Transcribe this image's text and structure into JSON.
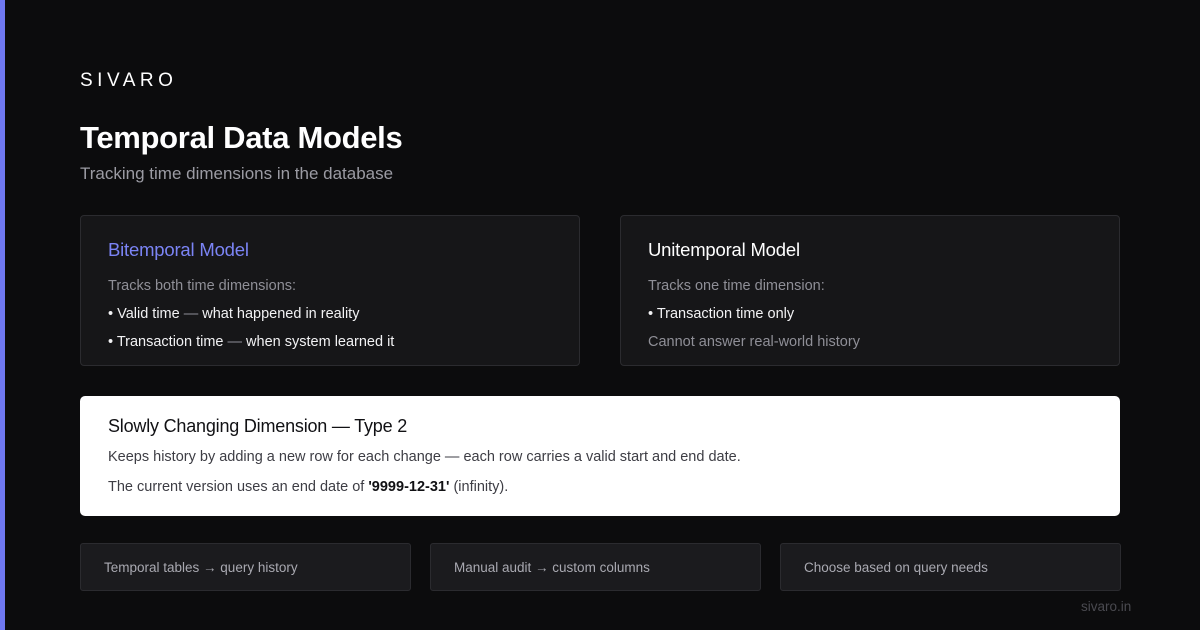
{
  "brand": "SIVARO",
  "title": "Temporal Data Models",
  "subtitle": "Tracking time dimensions in the database",
  "cards": [
    {
      "title": "Bitemporal Model",
      "intro": "Tracks both time dimensions:",
      "line2_a": "• Valid time",
      "line2_sep": "—",
      "line2_b": "what happened in reality",
      "line3_a": "• Transaction time",
      "line3_sep": "—",
      "line3_b": "when system learned it"
    },
    {
      "title": "Unitemporal Model",
      "intro": "Tracks one time dimension:",
      "line2": "• Transaction time only",
      "line3": "Cannot answer real-world history"
    }
  ],
  "scd": {
    "title": "Slowly Changing Dimension — Type 2",
    "line1": "Keeps history by adding a new row for each change — each row carries a valid start and end date.",
    "line2_prefix": "The current version uses an end date of",
    "line2_value": "'9999-12-31'",
    "line2_suffix": "(infinity)."
  },
  "chips": [
    "Temporal tables → query history",
    "Manual audit → custom columns",
    "Choose based on query needs"
  ],
  "footer": "sivaro.in",
  "colors": {
    "accent": "#6f78f0",
    "card_title_accent": "#7b84f5",
    "background": "#0c0c0d"
  }
}
